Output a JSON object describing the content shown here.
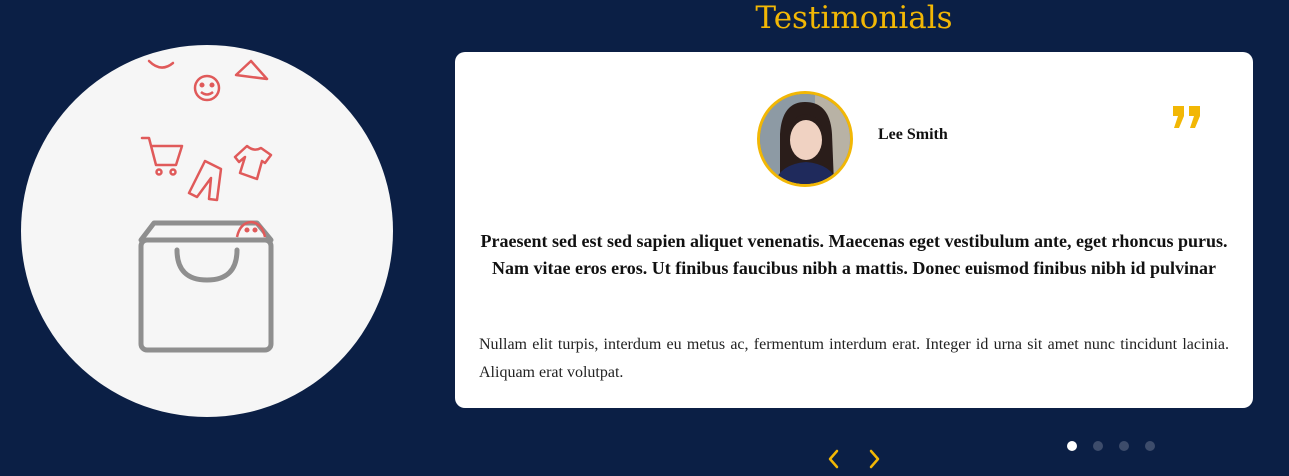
{
  "section": {
    "title": "Testimonials"
  },
  "testimonial": {
    "name": "Lee Smith",
    "headline": "Praesent sed est sed sapien aliquet venenatis. Maecenas eget vestibulum ante, eget rhoncus purus. Nam vitae eros eros. Ut finibus faucibus nibh a mattis. Donec euismod finibus nibh id pulvinar",
    "body": "Nullam elit turpis, interdum eu metus ac, fermentum interdum erat. Integer id urna sit amet nunc tincidunt lacinia. Aliquam erat volutpat."
  },
  "carousel": {
    "active_index": 0,
    "total": 4
  },
  "colors": {
    "background": "#0b1f45",
    "accent": "#f2b705",
    "illustration": "#e05a5a",
    "bag": "#8f8f8f"
  },
  "icons": [
    "shopping-bag-icon",
    "cart-icon",
    "smiley-icon",
    "tshirt-icon",
    "trousers-icon",
    "quote-icon",
    "chevron-left-icon",
    "chevron-right-icon"
  ]
}
